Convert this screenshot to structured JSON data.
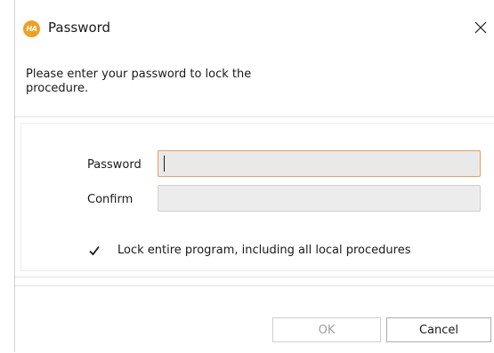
{
  "window": {
    "title": "Password",
    "app_icon_text": "HA",
    "close_glyph": "close-icon"
  },
  "prompt": {
    "text": "Please enter your password to lock the procedure."
  },
  "form": {
    "password_label": "Password",
    "password_value": "",
    "confirm_label": "Confirm",
    "confirm_value": ""
  },
  "options": {
    "lock_all_label": "Lock entire program, including all local procedures",
    "lock_all_checked": true
  },
  "buttons": {
    "ok_label": "OK",
    "ok_enabled": false,
    "cancel_label": "Cancel"
  },
  "colors": {
    "app_icon": "#f0a020",
    "focus_border": "#e8a060",
    "input_bg": "#ececec"
  }
}
